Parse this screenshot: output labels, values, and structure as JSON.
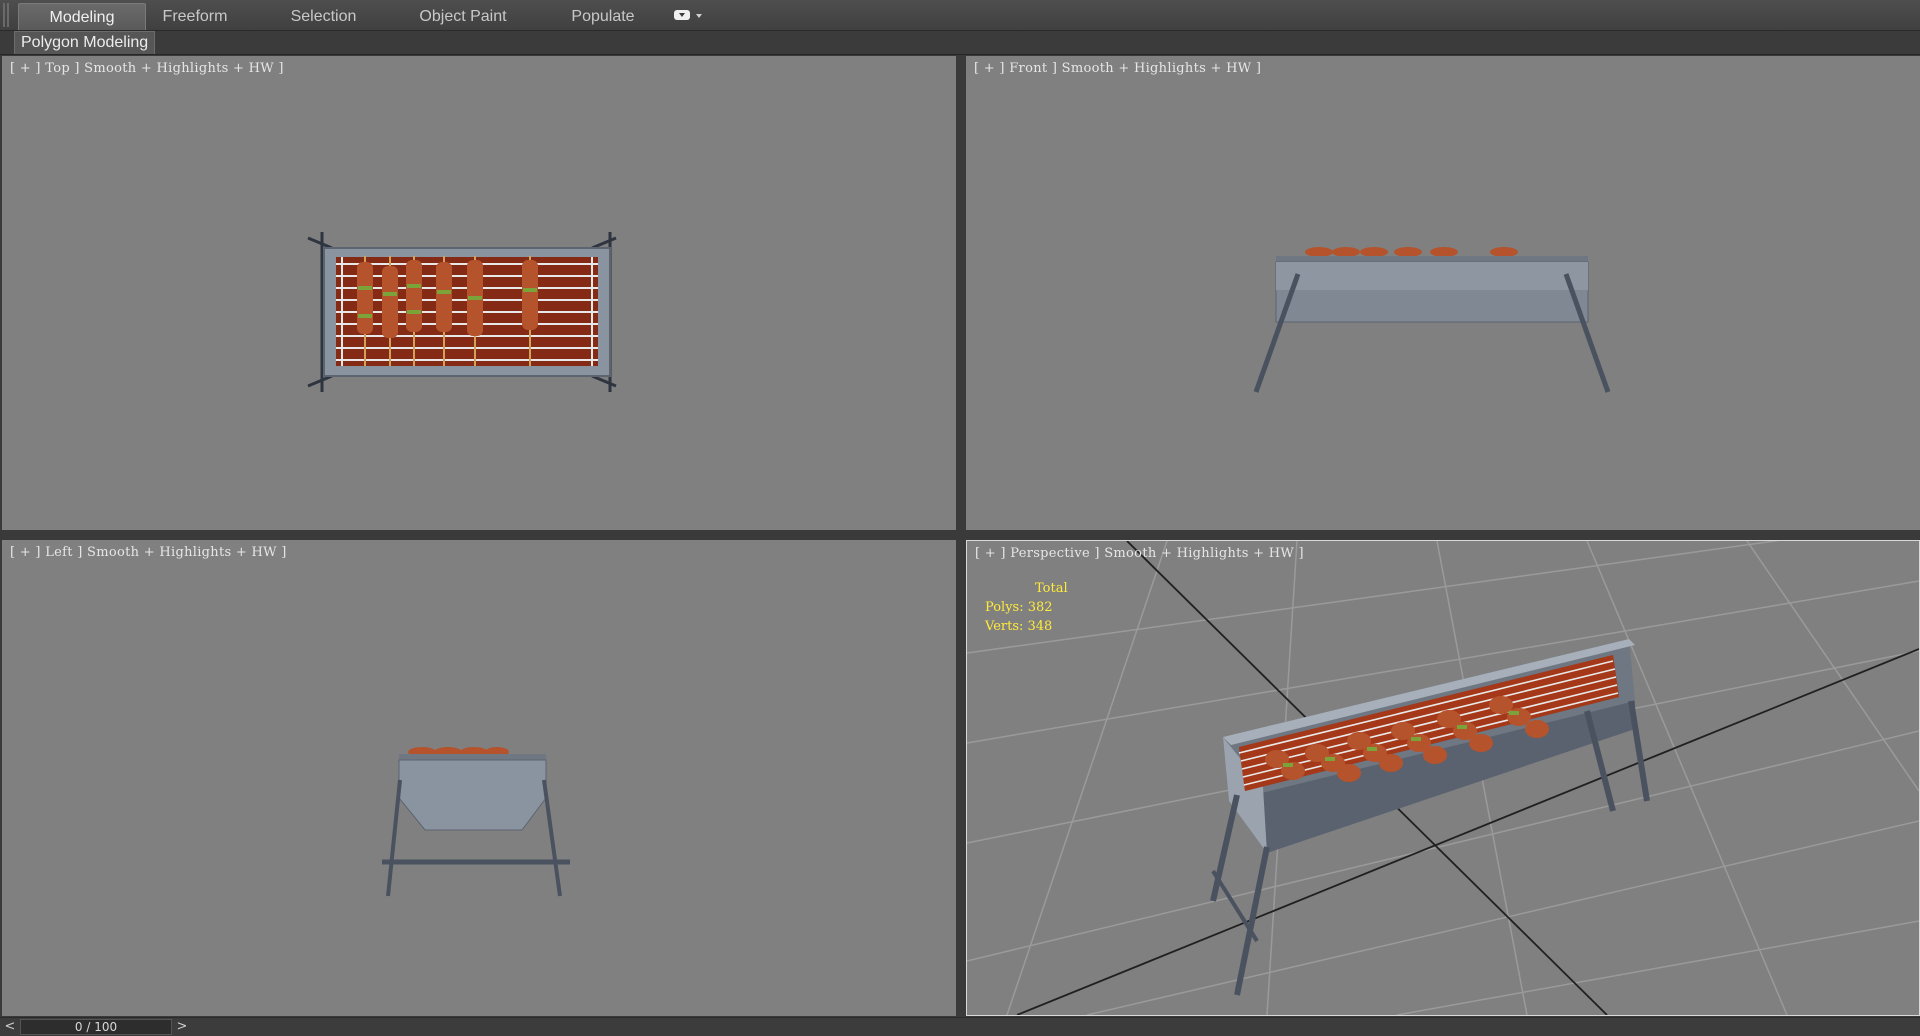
{
  "ribbon": {
    "tabs": [
      "Modeling",
      "Freeform",
      "Selection",
      "Object Paint",
      "Populate"
    ],
    "active_tab": "Modeling",
    "panel_label": "Polygon Modeling"
  },
  "viewports": {
    "top": {
      "label": "[ + ] Top ] Smooth + Highlights + HW ]"
    },
    "front": {
      "label": "[ + ] Front ] Smooth + Highlights + HW ]"
    },
    "left": {
      "label": "[ + ] Left ] Smooth + Highlights + HW ]"
    },
    "perspective": {
      "label": "[ + ] Perspective ] Smooth + Highlights + HW ]",
      "stats": {
        "header": "Total",
        "polys": "Polys: 382",
        "verts": "Verts: 348"
      }
    }
  },
  "timeline": {
    "frame_display": "0 / 100",
    "prev": "<",
    "next": ">"
  },
  "colors": {
    "viewport_bg": "#808080",
    "stats_text": "#ffea3a",
    "grill_metal": "#8a93a0",
    "meat": "#b5532c",
    "embers": "#c23a1a"
  }
}
